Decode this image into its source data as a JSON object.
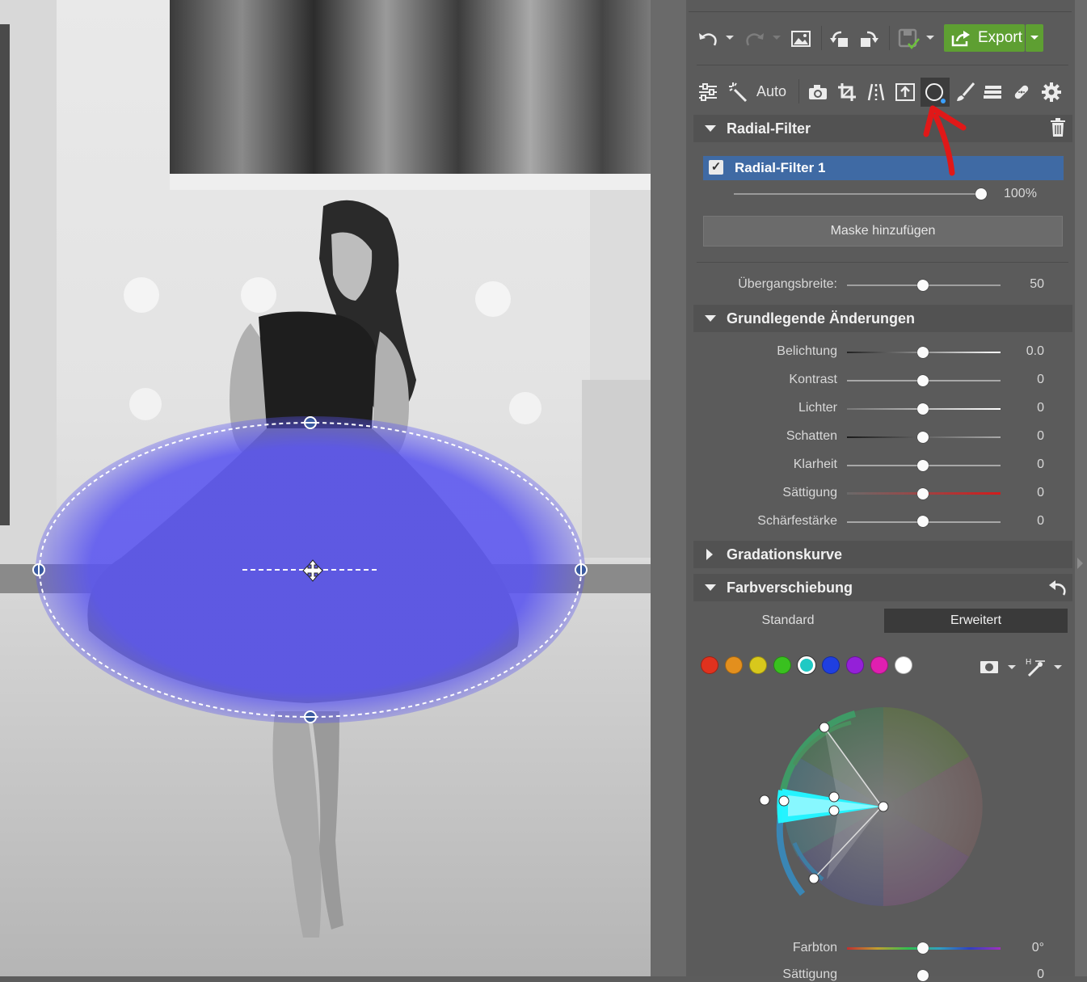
{
  "toolbar": {
    "export_label": "Export",
    "auto_label": "Auto"
  },
  "radial_section": {
    "title": "Radial-Filter",
    "filter_name": "Radial-Filter 1",
    "opacity": "100%",
    "add_mask_label": "Maske hinzufügen",
    "transition_label": "Übergangsbreite:",
    "transition_value": "50"
  },
  "basic_section": {
    "title": "Grundlegende Änderungen",
    "sliders": [
      {
        "label": "Belichtung",
        "value": "0.0"
      },
      {
        "label": "Kontrast",
        "value": "0"
      },
      {
        "label": "Lichter",
        "value": "0"
      },
      {
        "label": "Schatten",
        "value": "0"
      },
      {
        "label": "Klarheit",
        "value": "0"
      },
      {
        "label": "Sättigung",
        "value": "0"
      },
      {
        "label": "Schärfestärke",
        "value": "0"
      }
    ]
  },
  "curve_section": {
    "title": "Gradationskurve"
  },
  "color_shift_section": {
    "title": "Farbverschiebung",
    "tabs": [
      "Standard",
      "Erweitert"
    ],
    "active_tab": "Erweitert",
    "swatches": [
      "#e0321e",
      "#e38f1d",
      "#d8c81c",
      "#39c11f",
      "#20c9c4",
      "#1f3fe0",
      "#9420d8",
      "#e01fb0",
      "#ffffff"
    ],
    "selected_swatch": "#20c9c4",
    "hue_label": "Farbton",
    "hue_value": "0°",
    "sat_label": "Sättigung",
    "sat_value": "0"
  },
  "annotation": {
    "arrow_color": "#e01818"
  },
  "mask_overlay_color": "#5a55f0"
}
